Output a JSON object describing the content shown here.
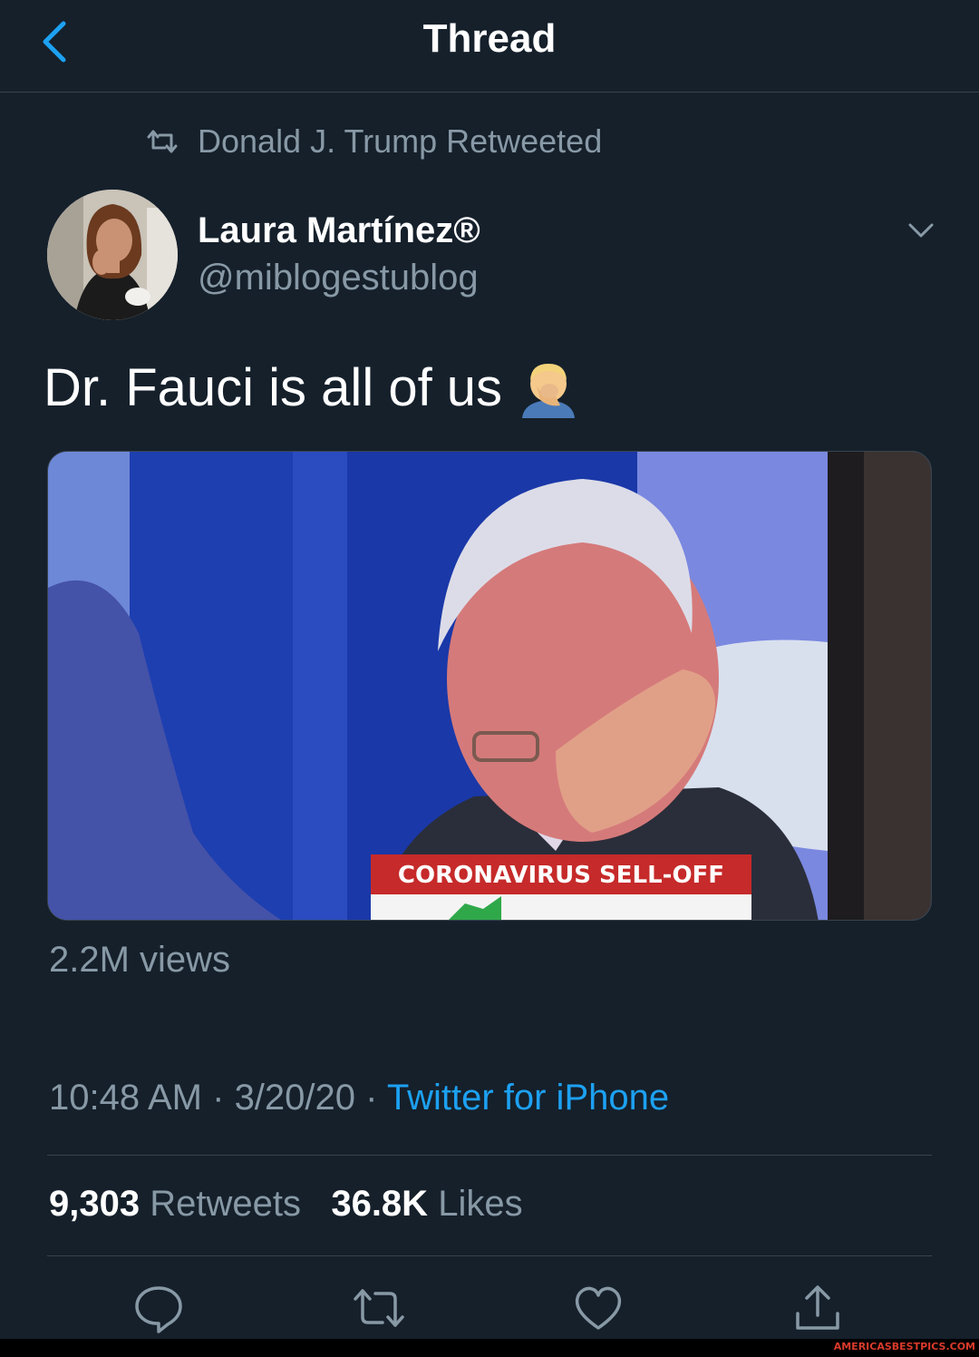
{
  "header": {
    "title": "Thread",
    "back_icon": "chevron-left-icon"
  },
  "retweet_context": {
    "text": "Donald J. Trump Retweeted",
    "icon": "retweet-icon"
  },
  "author": {
    "name": "Laura Martínez®",
    "handle": "@miblogestublog"
  },
  "tweet": {
    "text": "Dr. Fauci is all of us",
    "emoji": "person-facepalming",
    "media": {
      "chyron": "CORONAVIRUS SELL-OFF"
    },
    "views": "2.2M views",
    "time": "10:48 AM",
    "separator": " · ",
    "date": "3/20/20",
    "source": "Twitter for iPhone"
  },
  "stats": {
    "retweets_count": "9,303",
    "retweets_label": "Retweets",
    "likes_count": "36.8K",
    "likes_label": "Likes"
  },
  "actions": [
    "reply-icon",
    "retweet-icon",
    "like-icon",
    "share-icon"
  ],
  "colors": {
    "background": "#15202b",
    "accent": "#1da1f2",
    "secondary_text": "#8899a6",
    "divider": "#38444d"
  },
  "watermark": "AMERICASBESTPICS.COM"
}
